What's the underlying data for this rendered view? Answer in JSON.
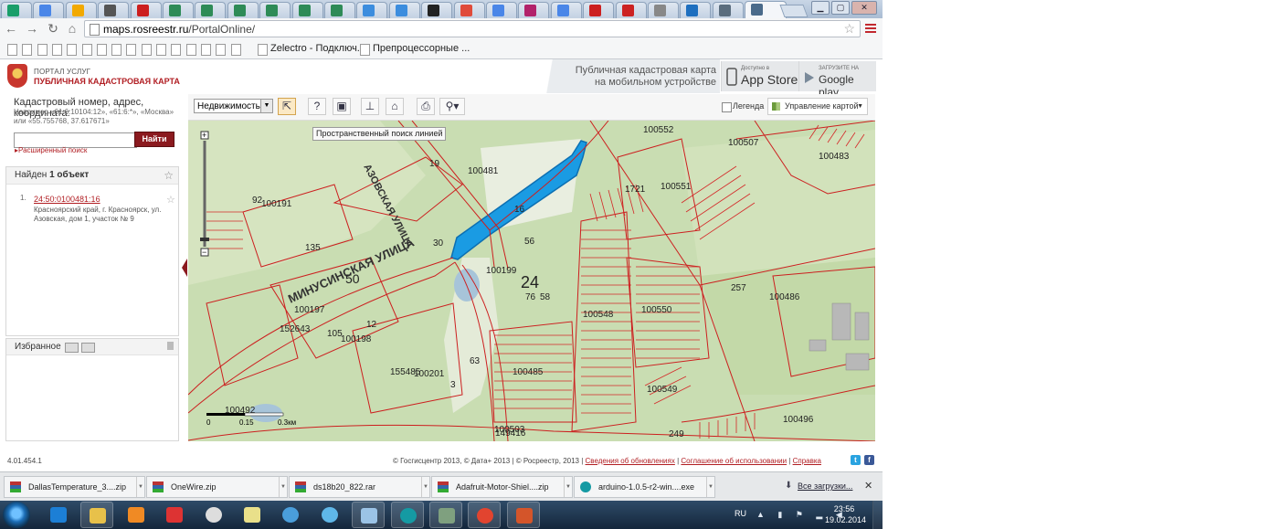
{
  "browser": {
    "url_host": "maps.rosreestr.ru",
    "url_path": "/PortalOnline/",
    "bookmarks": [
      "Zelectro - Подключ...",
      "Препроцессорные ..."
    ]
  },
  "site": {
    "portal_small": "ПОРТАЛ УСЛУГ",
    "portal_title": "ПУБЛИЧНАЯ КАДАСТРОВАЯ КАРТА",
    "promo_line1": "Публичная кадастровая карта",
    "promo_line2": "на мобильном устройстве",
    "appstore_small": "Доступно в",
    "appstore_big": "App Store",
    "gplay_small": "ЗАГРУЗИТЕ НА",
    "gplay_big": "Google play"
  },
  "left": {
    "search_label": "Кадастровый номер, адрес, координата:",
    "search_hint": "Например «61:6:10104:12», «61:6:*», «Москва» или «55.755768, 37.617671»",
    "search_value": "",
    "find_button": "Найти",
    "advanced_search": "Расширенный поиск",
    "found_prefix": "Найден ",
    "found_count": "1 объект",
    "result_number": "1.",
    "result_id": "24:50:0100481:16",
    "result_address": "Красноярский край, г. Красноярск, ул. Азовская, дом 1, участок № 9",
    "favorites": "Избранное"
  },
  "map_toolbar": {
    "layer": "Недвижимость",
    "legend": "Легенда",
    "map_management": "Управление картой",
    "tooltip": "Пространственный поиск линией"
  },
  "map": {
    "labels": [
      "100481",
      "100191",
      "100552",
      "100507",
      "100483",
      "100551",
      "1721",
      "100199",
      "24",
      "50",
      "100197",
      "100198",
      "100201",
      "100485",
      "100503",
      "100496",
      "100549",
      "100550",
      "100548",
      "100486",
      "152643",
      "155485",
      "149416",
      "100492",
      "19",
      "92",
      "135",
      "30",
      "56",
      "76",
      "58",
      "63",
      "257",
      "249",
      "12",
      "16",
      "105",
      "3"
    ],
    "streets": [
      "МИНУСИНСКАЯ УЛИЦА",
      "АЗОВСКАЯ УЛИЦА"
    ],
    "scale": [
      "0",
      "0.15",
      "0.3км"
    ]
  },
  "footer": {
    "version": "4.01.454.1",
    "credits": "© Госгисцентр 2013, © Дата+ 2013 | © Росреестр, 2013 |",
    "link_updates": "Сведения об обновлениях",
    "link_terms": "Соглашение об использовании",
    "link_help": "Справка"
  },
  "downloads": {
    "items": [
      "DallasTemperature_3....zip",
      "OneWire.zip",
      "ds18b20_822.rar",
      "Adafruit-Motor-Shiel....zip",
      "arduino-1.0.5-r2-win....exe"
    ],
    "all": "Все загрузки..."
  },
  "taskbar": {
    "lang": "RU",
    "time": "23:56",
    "date": "19.02.2014"
  }
}
